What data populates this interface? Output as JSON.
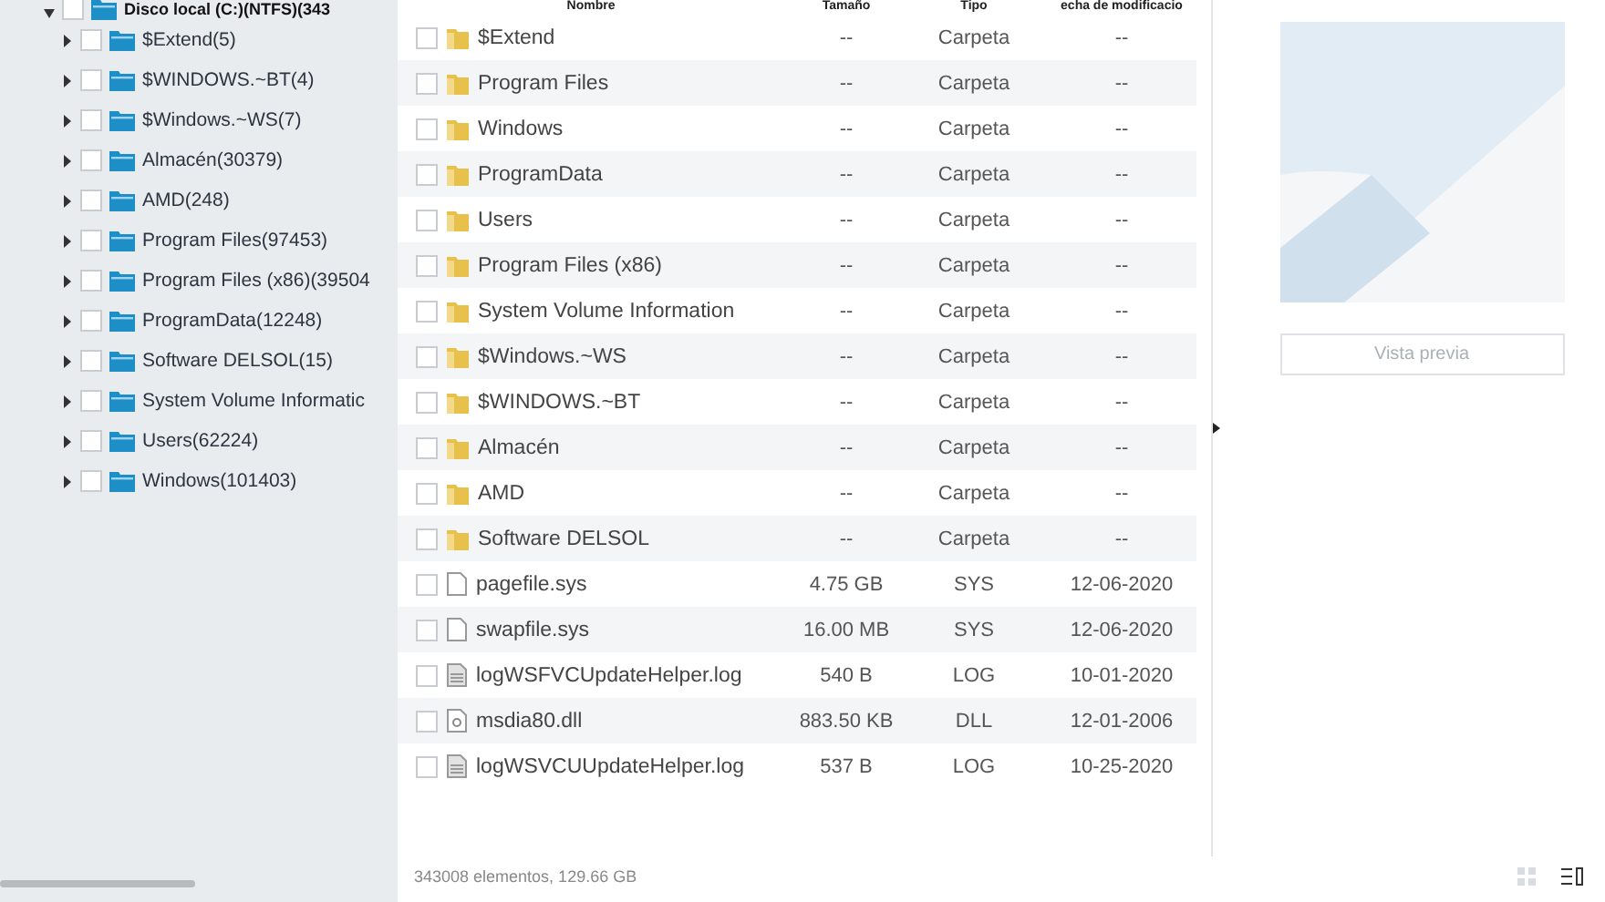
{
  "tree": {
    "label": "Disco local (C:)(NTFS)(343",
    "expanded": true,
    "checked": false,
    "children": [
      {
        "label": "$Extend(5)",
        "expanded": false,
        "checked": false
      },
      {
        "label": "$WINDOWS.~BT(4)",
        "expanded": false,
        "checked": false
      },
      {
        "label": "$Windows.~WS(7)",
        "expanded": false,
        "checked": false
      },
      {
        "label": "Almacén(30379)",
        "expanded": false,
        "checked": false
      },
      {
        "label": "AMD(248)",
        "expanded": false,
        "checked": false
      },
      {
        "label": "Program Files(97453)",
        "expanded": false,
        "checked": false
      },
      {
        "label": "Program Files (x86)(39504",
        "expanded": false,
        "checked": false
      },
      {
        "label": "ProgramData(12248)",
        "expanded": false,
        "checked": false
      },
      {
        "label": "Software DELSOL(15)",
        "expanded": false,
        "checked": false
      },
      {
        "label": "System Volume Informatic",
        "expanded": false,
        "checked": false
      },
      {
        "label": "Users(62224)",
        "expanded": false,
        "checked": false
      },
      {
        "label": "Windows(101403)",
        "expanded": false,
        "checked": false
      }
    ]
  },
  "table": {
    "columns": [
      "Nombre",
      "Tamaño",
      "Tipo",
      "echa de modificacio"
    ],
    "rows": [
      {
        "kind": "folder",
        "name": "$Extend",
        "size": "--",
        "type": "Carpeta",
        "date": "--",
        "checked": false
      },
      {
        "kind": "folder",
        "name": "Program Files",
        "size": "--",
        "type": "Carpeta",
        "date": "--",
        "checked": false
      },
      {
        "kind": "folder",
        "name": "Windows",
        "size": "--",
        "type": "Carpeta",
        "date": "--",
        "checked": false
      },
      {
        "kind": "folder",
        "name": "ProgramData",
        "size": "--",
        "type": "Carpeta",
        "date": "--",
        "checked": false
      },
      {
        "kind": "folder",
        "name": "Users",
        "size": "--",
        "type": "Carpeta",
        "date": "--",
        "checked": false
      },
      {
        "kind": "folder",
        "name": "Program Files (x86)",
        "size": "--",
        "type": "Carpeta",
        "date": "--",
        "checked": false
      },
      {
        "kind": "folder",
        "name": "System Volume Information",
        "size": "--",
        "type": "Carpeta",
        "date": "--",
        "checked": false
      },
      {
        "kind": "folder",
        "name": "$Windows.~WS",
        "size": "--",
        "type": "Carpeta",
        "date": "--",
        "checked": false
      },
      {
        "kind": "folder",
        "name": "$WINDOWS.~BT",
        "size": "--",
        "type": "Carpeta",
        "date": "--",
        "checked": false
      },
      {
        "kind": "folder",
        "name": "Almacén",
        "size": "--",
        "type": "Carpeta",
        "date": "--",
        "checked": false
      },
      {
        "kind": "folder",
        "name": "AMD",
        "size": "--",
        "type": "Carpeta",
        "date": "--",
        "checked": false
      },
      {
        "kind": "folder",
        "name": "Software DELSOL",
        "size": "--",
        "type": "Carpeta",
        "date": "--",
        "checked": false
      },
      {
        "kind": "file",
        "name": "pagefile.sys",
        "size": "4.75 GB",
        "type": "SYS",
        "date": "12-06-2020",
        "checked": false
      },
      {
        "kind": "file",
        "name": "swapfile.sys",
        "size": "16.00 MB",
        "type": "SYS",
        "date": "12-06-2020",
        "checked": false
      },
      {
        "kind": "text",
        "name": "logWSFVCUpdateHelper.log",
        "size": "540 B",
        "type": "LOG",
        "date": "10-01-2020",
        "checked": false
      },
      {
        "kind": "library",
        "name": "msdia80.dll",
        "size": "883.50 KB",
        "type": "DLL",
        "date": "12-01-2006",
        "checked": false
      },
      {
        "kind": "text",
        "name": "logWSVCUUpdateHelper.log",
        "size": "537 B",
        "type": "LOG",
        "date": "10-25-2020",
        "checked": false
      }
    ]
  },
  "preview": {
    "button": "Vista previa"
  },
  "status_bar": {
    "text": "343008 elementos, 129.66 GB"
  }
}
